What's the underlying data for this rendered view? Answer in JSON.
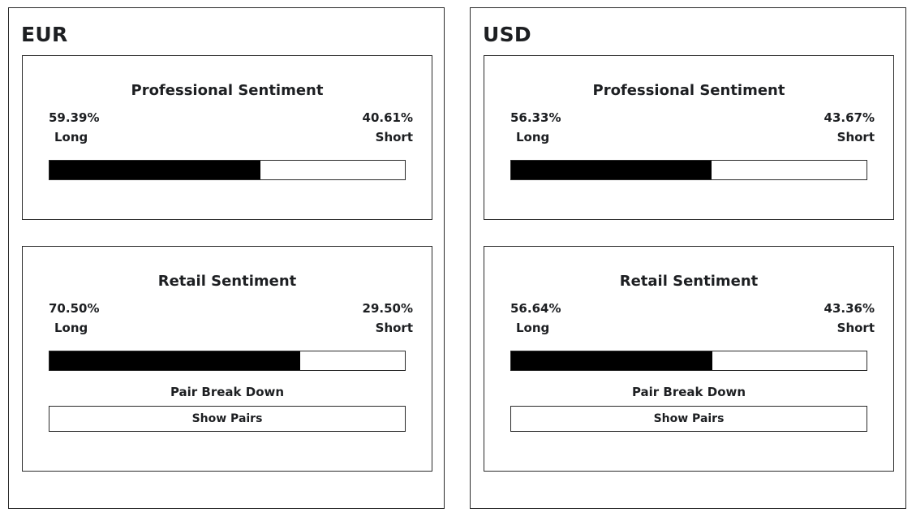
{
  "panels": [
    {
      "currency": "EUR",
      "professional": {
        "title": "Professional Sentiment",
        "long_pct_text": "59.39%",
        "short_pct_text": "40.61%",
        "long_label": "Long",
        "short_label": "Short",
        "long_share": 0.5939
      },
      "retail": {
        "title": "Retail Sentiment",
        "long_pct_text": "70.50%",
        "short_pct_text": "29.50%",
        "long_label": "Long",
        "short_label": "Short",
        "long_share": 0.705,
        "breakdown_title": "Pair Break Down",
        "button_label": "Show Pairs"
      }
    },
    {
      "currency": "USD",
      "professional": {
        "title": "Professional Sentiment",
        "long_pct_text": "56.33%",
        "short_pct_text": "43.67%",
        "long_label": "Long",
        "short_label": "Short",
        "long_share": 0.5633
      },
      "retail": {
        "title": "Retail Sentiment",
        "long_pct_text": "56.64%",
        "short_pct_text": "43.36%",
        "long_label": "Long",
        "short_label": "Short",
        "long_share": 0.5664,
        "breakdown_title": "Pair Break Down",
        "button_label": "Show Pairs"
      }
    }
  ],
  "colors": {
    "bar_fill": "#000000",
    "bar_track": "#ffffff",
    "border": "#2a2a2a",
    "text": "#1d1f22"
  }
}
